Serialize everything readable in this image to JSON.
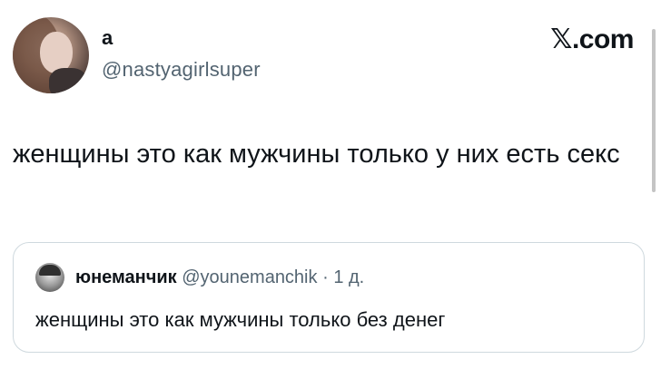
{
  "tweet": {
    "author": {
      "display_name": "а",
      "handle": "@nastyagirlsuper"
    },
    "text": "женщины это как мужчины только у них есть секс"
  },
  "brand": {
    "label": "𝕏.com"
  },
  "quoted_tweet": {
    "author": {
      "display_name": "юнеманчик",
      "handle": "@younemanchik"
    },
    "separator": "·",
    "time": "1 д.",
    "text": "женщины это как мужчины только без денег"
  }
}
